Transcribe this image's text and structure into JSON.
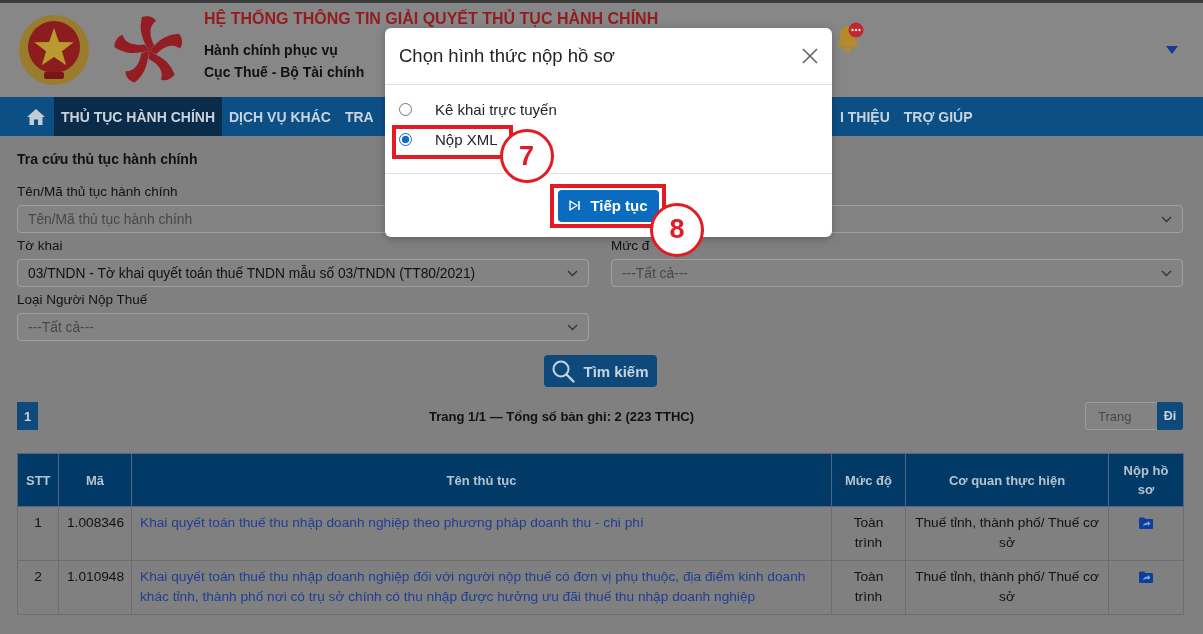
{
  "header": {
    "title": "HỆ THỐNG THÔNG TIN GIẢI QUYẾT THỦ TỤC HÀNH CHÍNH",
    "subtitle": [
      "Hành chính phục vụ",
      "Cục Thuế - Bộ Tài chính"
    ]
  },
  "nav": {
    "items": [
      {
        "label": "THỦ TỤC HÀNH CHÍNH",
        "selected": true
      },
      {
        "label": "DỊCH VỤ KHÁC",
        "selected": false
      },
      {
        "label": "TRA",
        "selected": false
      }
    ],
    "trailing_items": [
      {
        "label": "I THIỆU",
        "selected": false
      },
      {
        "label": "TRỢ GIÚP",
        "selected": false
      }
    ]
  },
  "search_form": {
    "title": "Tra cứu thủ tục hành chính",
    "fields": [
      {
        "kind": "text",
        "label": "Tên/Mã thủ tục hành chính",
        "placeholder": "Tên/Mã thủ tục hành chính"
      },
      {
        "kind": "select"
      },
      {
        "kind": "select",
        "label": "Tờ khai",
        "value": "03/TNDN - Tờ khai quyết toán thuế TNDN mẫu số 03/TNDN (TT80/2021)"
      },
      {
        "kind": "select",
        "label": "Mức đ",
        "placeholder": "---Tất cả---"
      },
      {
        "kind": "select",
        "label": "Loại Người Nộp Thuế",
        "placeholder": "---Tất cả---"
      }
    ],
    "search_button": "Tìm kiếm"
  },
  "pagination": {
    "pages": [
      {
        "label": "1",
        "selected": true
      }
    ],
    "summary": "Trang 1/1 — Tổng số bản ghi: 2 (223 TTHC)",
    "page_input": {
      "placeholder": "Trang"
    },
    "go_button": "Đi"
  },
  "table": {
    "columns": [
      "STT",
      "Mã",
      "Tên thủ tục",
      "Mức độ",
      "Cơ quan thực hiện",
      "Nộp hồ sơ"
    ],
    "rows": [
      {
        "stt": "1",
        "code": "1.008346",
        "name": "Khai quyết toán thuế thu nhập doanh nghiệp theo phương pháp doanh thu - chi phí",
        "scope": "Toàn trình",
        "agency": "Thuế tỉnh, thành phố/ Thuế cơ sở"
      },
      {
        "stt": "2",
        "code": "1.010948",
        "name": "Khai quyết toán thuế thu nhập doanh nghiệp đối với người nộp thuế có đơn vị phụ thuộc, địa điểm kinh doanh khác tỉnh, thành phố nơi có trụ sở chính có thu nhập được hưởng ưu đãi thuế thu nhập doanh nghiệp",
        "scope": "Toàn trình",
        "agency": "Thuế tỉnh, thành phố/ Thuế cơ sở"
      }
    ]
  },
  "dialog": {
    "title": "Chọn hình thức nộp hồ sơ",
    "options": [
      {
        "label": "Kê khai trực tuyến",
        "selected": false
      },
      {
        "label": "Nộp XML",
        "selected": true,
        "annotation": "7"
      }
    ],
    "confirm_button": {
      "label": "Tiếp tục",
      "annotation": "8"
    }
  }
}
